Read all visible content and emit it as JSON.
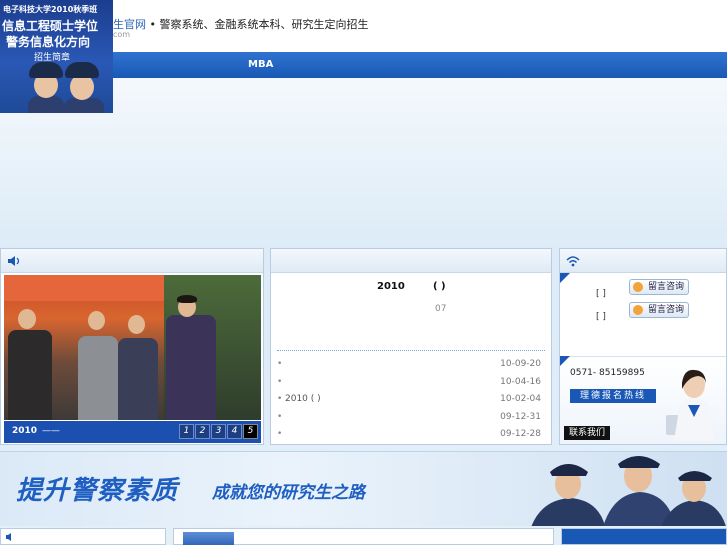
{
  "header": {
    "site_name": "生官网",
    "separator": "•",
    "headline": "警察系统、金融系统本科、研究生定向招生",
    "domain_fragment": "com"
  },
  "promo": {
    "line1": "电子科技大学2010秋季班",
    "line2": "信息工程硕士学位",
    "line3": "警务信息化方向",
    "line4": "招生简章"
  },
  "nav": {
    "item": "MBA"
  },
  "slideshow": {
    "caption_year": "2010",
    "caption_dash": "——",
    "pages": [
      "1",
      "2",
      "3",
      "4",
      "5"
    ],
    "active_page": "5"
  },
  "news": {
    "featured_title": "2010",
    "featured_paren": "( )",
    "featured_sub": "07",
    "items": [
      {
        "bullet": "•",
        "title": "",
        "date": "10-09-20"
      },
      {
        "bullet": "•",
        "title": "",
        "date": "10-04-16"
      },
      {
        "bullet": "•",
        "title": "2010    ( )",
        "date": "10-02-04"
      },
      {
        "bullet": "•",
        "title": "",
        "date": "09-12-31"
      },
      {
        "bullet": "•",
        "title": "",
        "date": "09-12-28"
      }
    ]
  },
  "contact": {
    "row1_bracket": "[ ]",
    "row2_bracket": "[ ]",
    "consult_label": "留言咨询",
    "phone": "0571- 85159895",
    "hotline": "理德报名热线",
    "contact_us": "联系我们"
  },
  "banner": {
    "main": "提升警察素质",
    "sub": "成就您的研究生之路"
  },
  "colors": {
    "brand_blue": "#1a58b6",
    "nav_blue": "#2f73cf",
    "panel_border": "#b8cde3"
  }
}
